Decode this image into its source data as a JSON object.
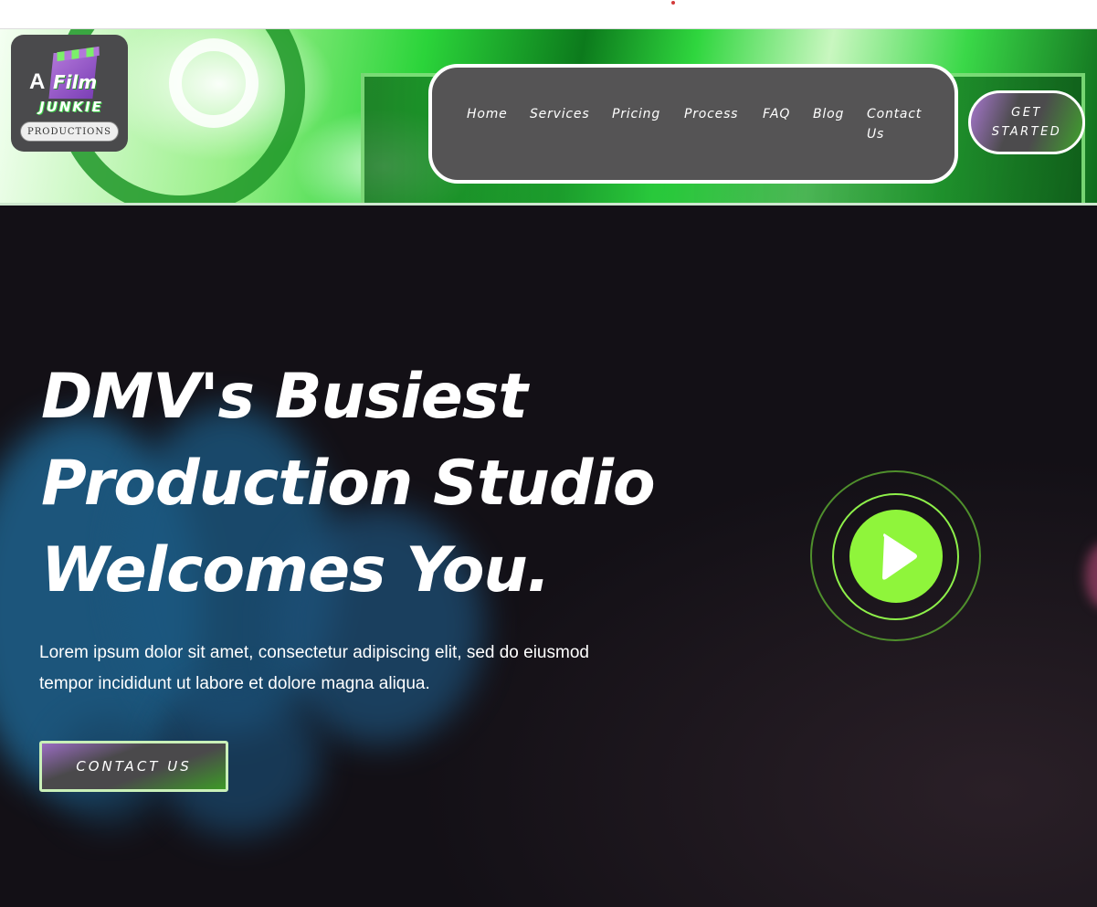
{
  "header": {
    "logo": {
      "line_a": "A",
      "line_film": "Film",
      "line_junkie": "JUNKIE",
      "line_productions": "PRODUCTIONS"
    },
    "nav": [
      {
        "label": "Home"
      },
      {
        "label": "Services"
      },
      {
        "label": "Pricing"
      },
      {
        "label": "Process"
      },
      {
        "label": "FAQ"
      },
      {
        "label": "Blog"
      },
      {
        "label": "Contact Us"
      }
    ],
    "cta_label": "GET STARTED"
  },
  "hero": {
    "title_line1": "DMV's Busiest",
    "title_line2": "Production Studio",
    "title_line3": "Welcomes You.",
    "text_line1": "Lorem ipsum dolor sit amet, consectetur adipiscing elit, sed do eiusmod",
    "text_line2": "tempor incididunt ut labore et dolore magna aliqua.",
    "button_label": "CONTACT US"
  },
  "colors": {
    "accent_green": "#8ff53b",
    "nav_background": "#555455",
    "hero_background": "#131016",
    "logo_purple": "#b277d9"
  },
  "icons": {
    "play": "play-icon"
  }
}
